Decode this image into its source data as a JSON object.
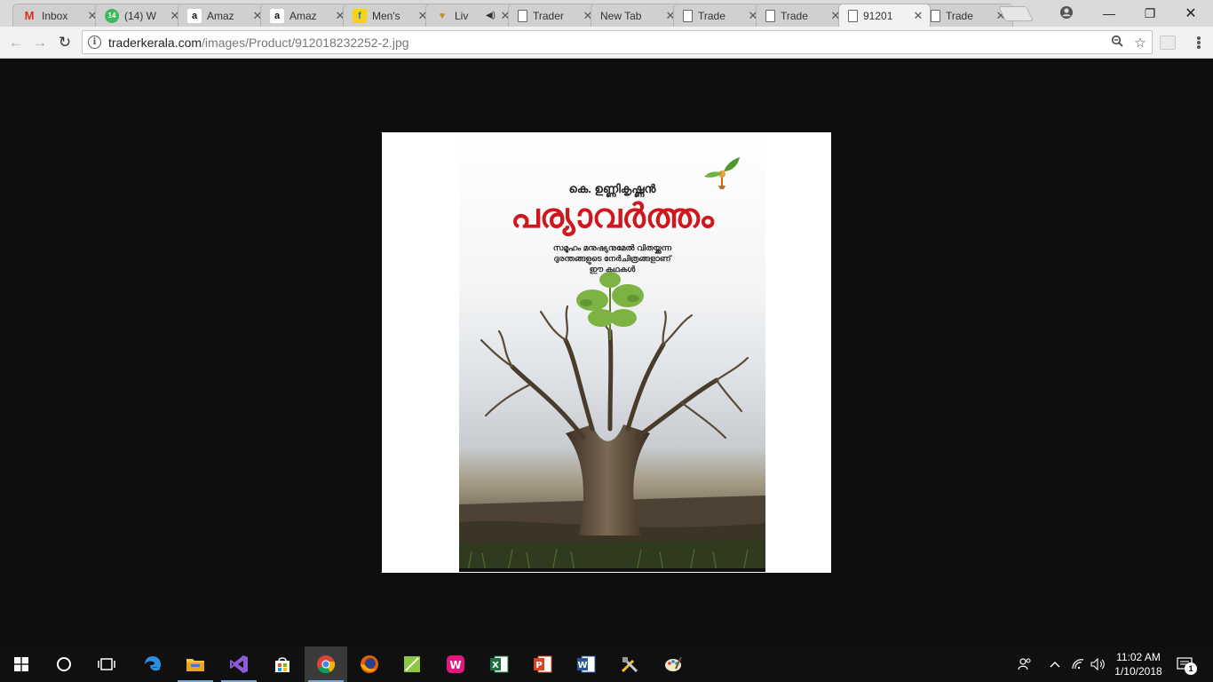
{
  "tabs": [
    {
      "title": "Inbox",
      "icon": "gmail-icon",
      "glyph": "M"
    },
    {
      "title": "(14) W",
      "icon": "whatsapp-icon",
      "glyph": "14"
    },
    {
      "title": "Amaz",
      "icon": "amazon-icon",
      "glyph": "a"
    },
    {
      "title": "Amaz",
      "icon": "amazon-icon",
      "glyph": "a"
    },
    {
      "title": "Men's",
      "icon": "flipkart-icon",
      "glyph": "f"
    },
    {
      "title": "Liv",
      "icon": "live-icon",
      "glyph": "♥"
    },
    {
      "title": "Trader",
      "icon": "page-icon",
      "glyph": ""
    },
    {
      "title": "New Tab",
      "icon": "none",
      "glyph": ""
    },
    {
      "title": "Trade",
      "icon": "page-icon",
      "glyph": ""
    },
    {
      "title": "Trade",
      "icon": "page-icon",
      "glyph": ""
    },
    {
      "title": "91201",
      "icon": "page-icon",
      "glyph": ""
    },
    {
      "title": "Trade",
      "icon": "page-icon",
      "glyph": ""
    }
  ],
  "active_tab_index": 10,
  "address_bar": {
    "host": "traderkerala.com",
    "path": "/images/Product/912018232252-2.jpg"
  },
  "book_cover": {
    "author": "കെ. ഉണ്ണികൃഷ്ണൻ",
    "title": "പര്യാവർത്തം",
    "tagline_lines": [
      "സമൂഹം മനുഷ്യനുമേൽ വിതയ്ക്കുന്ന",
      "ദുരന്തങ്ങളുടെ നേർചിത്രങ്ങളാണ്",
      "ഈ കഥകൾ"
    ]
  },
  "taskbar": {
    "apps": [
      "start-icon",
      "cortana-icon",
      "task-view-icon",
      "edge-icon",
      "file-explorer-icon",
      "visual-studio-icon",
      "store-icon",
      "chrome-icon",
      "firefox-icon",
      "green-app-icon",
      "wamp-icon",
      "excel-icon",
      "powerpoint-icon",
      "word-icon",
      "tools-icon",
      "paint-icon"
    ],
    "clock_time": "11:02 AM",
    "clock_date": "1/10/2018",
    "notification_count": "1"
  },
  "colors": {
    "title_red": "#d0171d",
    "viewer_bg": "#0e0e0e",
    "taskbar_bg": "#101010"
  }
}
